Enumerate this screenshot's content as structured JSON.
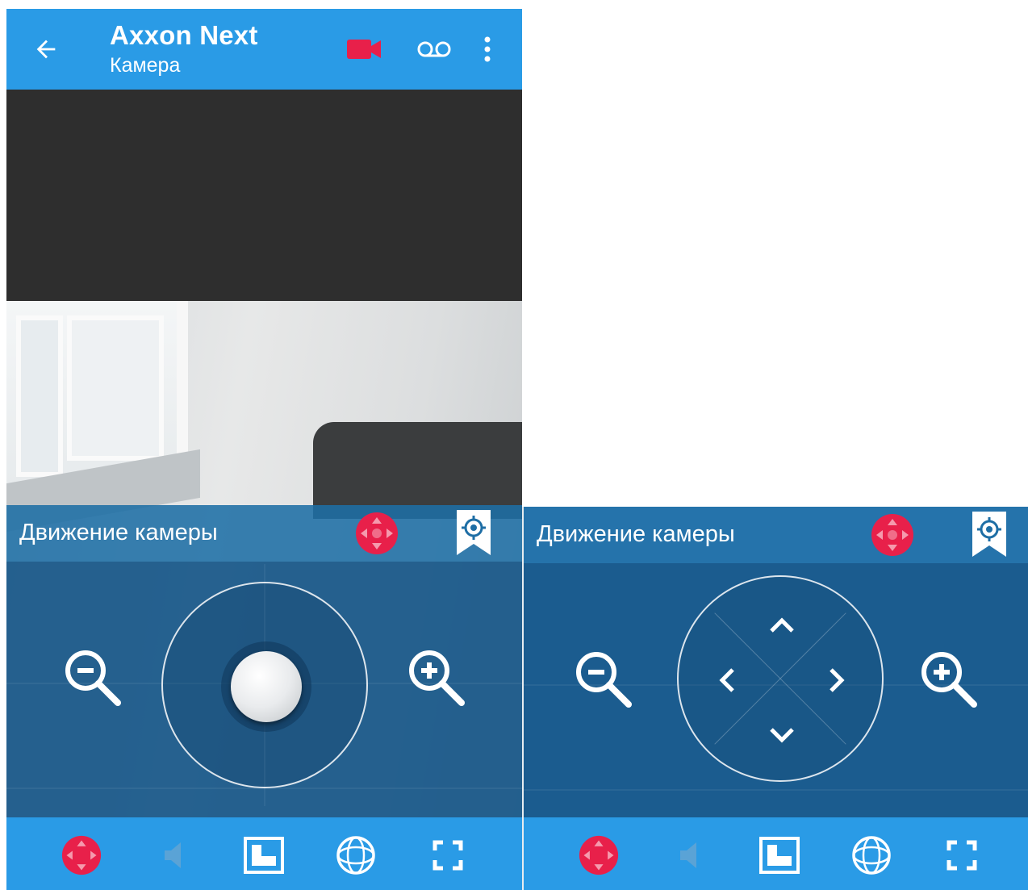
{
  "colors": {
    "appbar": "#2a9be6",
    "panel_header": "#1e6ea5",
    "panel_body": "#175688",
    "accent_red": "#e8204a",
    "white": "#ffffff"
  },
  "header": {
    "title": "Axxon Next",
    "subtitle": "Камера",
    "icons": [
      "back-arrow-icon",
      "video-camera-icon",
      "voicemail-icon",
      "more-vert-icon"
    ]
  },
  "left_panel": {
    "title": "Движение камеры",
    "mode": "joystick",
    "icons": [
      "ptz-move-icon",
      "preset-bookmark-icon",
      "zoom-out-icon",
      "zoom-in-icon"
    ]
  },
  "right_panel": {
    "title": "Движение камеры",
    "mode": "arrows",
    "icons": [
      "ptz-move-icon",
      "preset-bookmark-icon",
      "zoom-out-icon",
      "zoom-in-icon",
      "arrow-up-icon",
      "arrow-left-icon",
      "arrow-right-icon",
      "arrow-down-icon"
    ]
  },
  "bottom_bar": {
    "icons": [
      "ptz-move-icon",
      "audio-icon",
      "layout-icon",
      "fisheye-icon",
      "fullscreen-icon"
    ]
  }
}
